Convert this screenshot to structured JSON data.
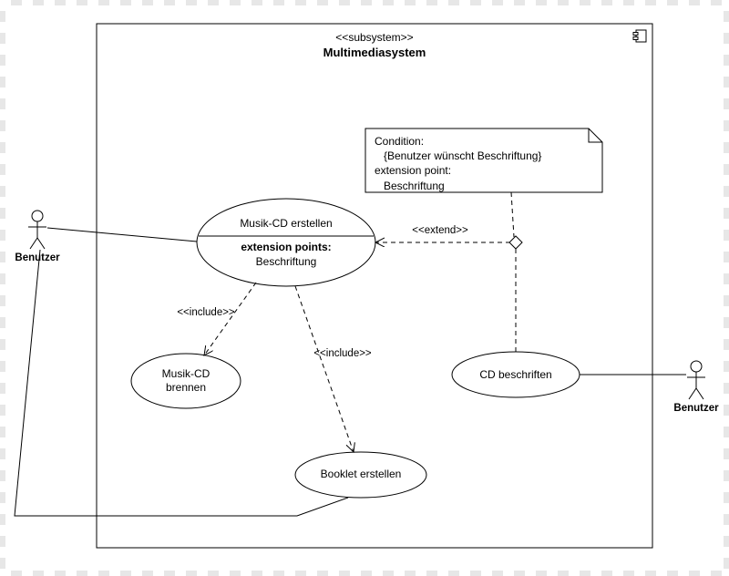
{
  "diagram": {
    "stereotype": "<<subsystem>>",
    "title": "Multimediasystem",
    "actors": {
      "left": "Benutzer",
      "right": "Benutzer"
    },
    "usecases": {
      "main": {
        "name": "Musik-CD erstellen",
        "ext_header": "extension points:",
        "ext_point": "Beschriftung"
      },
      "burn": "Musik-CD\nbrennen",
      "booklet": "Booklet erstellen",
      "label": "CD beschriften"
    },
    "note": {
      "l1": "Condition:",
      "l2": "{Benutzer wünscht Beschriftung}",
      "l3": "extension point:",
      "l4": "Beschriftung"
    },
    "rel": {
      "include1": "<<include>>",
      "include2": "<<include>>",
      "extend": "<<extend>>"
    }
  }
}
